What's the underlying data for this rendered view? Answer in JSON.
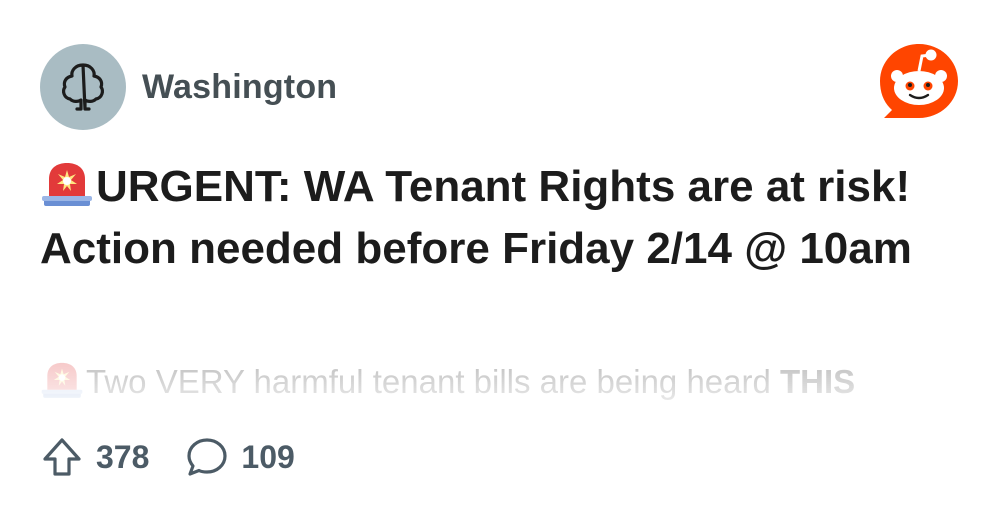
{
  "subreddit": {
    "name": "Washington",
    "avatar_icon": "tree-icon",
    "avatar_color": "#a9bcc3"
  },
  "brand": {
    "logo_icon": "reddit-logo-icon",
    "color": "#ff4500"
  },
  "post": {
    "title_emoji_icon": "rotating-light-icon",
    "title": "URGENT: WA Tenant Rights are at risk! Action needed before Friday 2/14 @ 10am",
    "preview_emoji_icon": "rotating-light-icon",
    "preview_text": "Two VERY harmful tenant bills are being heard ",
    "preview_bold_text": "THIS"
  },
  "stats": {
    "upvote_icon": "upvote-arrow-icon",
    "upvotes": "378",
    "comment_icon": "comment-bubble-icon",
    "comments": "109"
  },
  "colors": {
    "title_text": "#1c1c1c",
    "meta_text": "#4c5b66"
  }
}
